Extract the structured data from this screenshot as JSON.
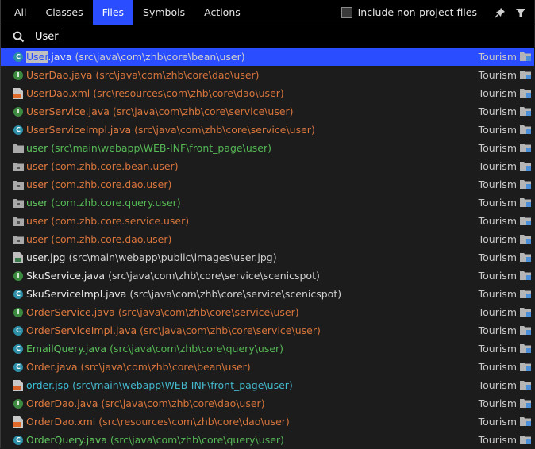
{
  "tabs": [
    {
      "label": "All",
      "active": false
    },
    {
      "label": "Classes",
      "active": false
    },
    {
      "label": "Files",
      "active": true
    },
    {
      "label": "Symbols",
      "active": false
    },
    {
      "label": "Actions",
      "active": false
    }
  ],
  "include_option": {
    "prefix": "Include ",
    "underlined": "n",
    "suffix": "on-project files",
    "checked": false
  },
  "search": {
    "query": "User"
  },
  "rows": [
    {
      "icon": "class",
      "hl": "User",
      "name": ".java",
      "path": "(src\\java\\com\\zhb\\core\\bean\\user)",
      "module": "Tourism",
      "color": "white",
      "selected": true
    },
    {
      "icon": "interface",
      "hl": "",
      "name": "UserDao.java",
      "path": "(src\\java\\com\\zhb\\core\\dao\\user)",
      "module": "Tourism",
      "color": "orange"
    },
    {
      "icon": "xml",
      "hl": "",
      "name": "UserDao.xml",
      "path": "(src\\resources\\com\\zhb\\core\\dao\\user)",
      "module": "Tourism",
      "color": "orange"
    },
    {
      "icon": "interface",
      "hl": "",
      "name": "UserService.java",
      "path": "(src\\java\\com\\zhb\\core\\service\\user)",
      "module": "Tourism",
      "color": "orange"
    },
    {
      "icon": "class",
      "hl": "",
      "name": "UserServiceImpl.java",
      "path": "(src\\java\\com\\zhb\\core\\service\\user)",
      "module": "Tourism",
      "color": "orange"
    },
    {
      "icon": "folder",
      "hl": "",
      "name": "user",
      "path": "(src\\main\\webapp\\WEB-INF\\front_page\\user)",
      "module": "Tourism",
      "color": "green"
    },
    {
      "icon": "package",
      "hl": "",
      "name": "user",
      "path": "(com.zhb.core.bean.user)",
      "module": "Tourism",
      "color": "orange"
    },
    {
      "icon": "package",
      "hl": "",
      "name": "user",
      "path": "(com.zhb.core.dao.user)",
      "module": "Tourism",
      "color": "orange"
    },
    {
      "icon": "package",
      "hl": "",
      "name": "user",
      "path": "(com.zhb.core.query.user)",
      "module": "Tourism",
      "color": "green"
    },
    {
      "icon": "package",
      "hl": "",
      "name": "user",
      "path": "(com.zhb.core.service.user)",
      "module": "Tourism",
      "color": "orange"
    },
    {
      "icon": "package",
      "hl": "",
      "name": "user",
      "path": "(com.zhb.core.dao.user)",
      "module": "Tourism",
      "color": "orange"
    },
    {
      "icon": "image",
      "hl": "",
      "name": "user.jpg",
      "path": "(src\\main\\webapp\\public\\images\\user.jpg)",
      "module": "Tourism",
      "color": "white"
    },
    {
      "icon": "interface",
      "hl": "",
      "name": "SkuService.java",
      "path": "(src\\java\\com\\zhb\\core\\service\\scenicspot)",
      "module": "Tourism",
      "color": "white"
    },
    {
      "icon": "class",
      "hl": "",
      "name": "SkuServiceImpl.java",
      "path": "(src\\java\\com\\zhb\\core\\service\\scenicspot)",
      "module": "Tourism",
      "color": "white"
    },
    {
      "icon": "interface",
      "hl": "",
      "name": "OrderService.java",
      "path": "(src\\java\\com\\zhb\\core\\service\\user)",
      "module": "Tourism",
      "color": "orange"
    },
    {
      "icon": "class",
      "hl": "",
      "name": "OrderServiceImpl.java",
      "path": "(src\\java\\com\\zhb\\core\\service\\user)",
      "module": "Tourism",
      "color": "orange"
    },
    {
      "icon": "class",
      "hl": "",
      "name": "EmailQuery.java",
      "path": "(src\\java\\com\\zhb\\core\\query\\user)",
      "module": "Tourism",
      "color": "green"
    },
    {
      "icon": "class",
      "hl": "",
      "name": "Order.java",
      "path": "(src\\java\\com\\zhb\\core\\bean\\user)",
      "module": "Tourism",
      "color": "orange"
    },
    {
      "icon": "jsp",
      "hl": "",
      "name": "order.jsp",
      "path": "(src\\main\\webapp\\WEB-INF\\front_page\\user)",
      "module": "Tourism",
      "color": "cyan"
    },
    {
      "icon": "interface",
      "hl": "",
      "name": "OrderDao.java",
      "path": "(src\\java\\com\\zhb\\core\\dao\\user)",
      "module": "Tourism",
      "color": "orange"
    },
    {
      "icon": "xml",
      "hl": "",
      "name": "OrderDao.xml",
      "path": "(src\\resources\\com\\zhb\\core\\dao\\user)",
      "module": "Tourism",
      "color": "orange"
    },
    {
      "icon": "class",
      "hl": "",
      "name": "OrderQuery.java",
      "path": "(src\\java\\com\\zhb\\core\\query\\user)",
      "module": "Tourism",
      "color": "green"
    }
  ],
  "colors": {
    "accent": "#2a4eff",
    "orange": "#e07a3f",
    "green": "#5fc55f",
    "cyan": "#3cc0d8"
  }
}
